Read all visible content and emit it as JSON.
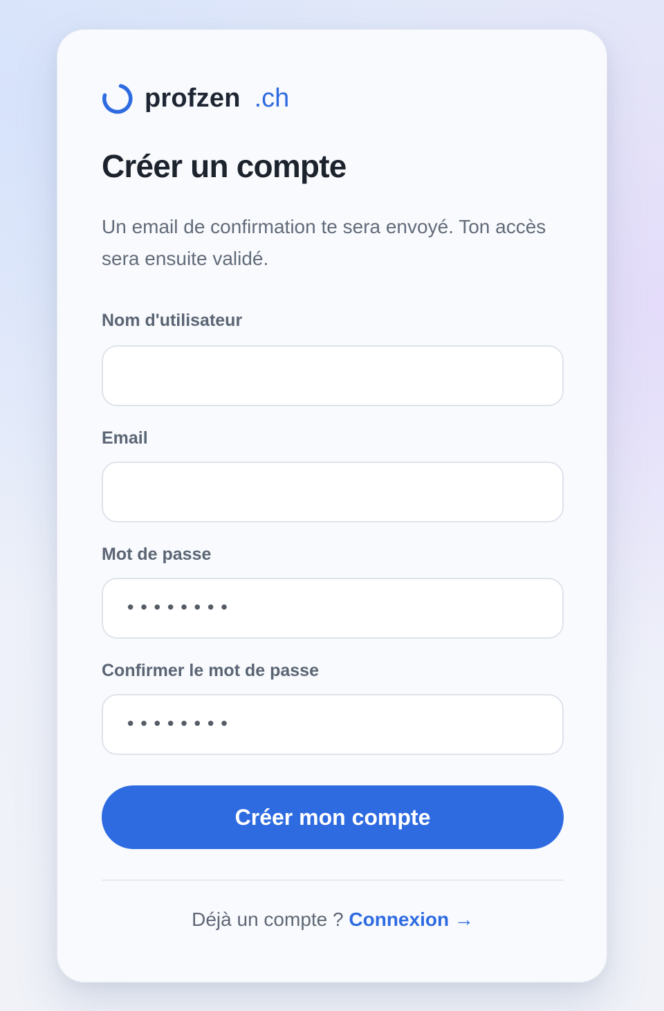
{
  "brand": {
    "name": "profzen",
    "tld": ".ch",
    "accent_color": "#2e6be1",
    "icon": "loader-ring-icon"
  },
  "page": {
    "title": "Créer un compte",
    "subtitle": "Un email de confirmation te sera envoyé. Ton accès sera ensuite validé."
  },
  "form": {
    "username": {
      "label": "Nom d'utilisateur",
      "value": ""
    },
    "email": {
      "label": "Email",
      "value": ""
    },
    "password": {
      "label": "Mot de passe",
      "value": "••••••••"
    },
    "confirm_password": {
      "label": "Confirmer le mot de passe",
      "value": "••••••••"
    },
    "submit_label": "Créer mon compte"
  },
  "footer": {
    "text": "Déjà un compte ?",
    "link_label": "Connexion →"
  }
}
